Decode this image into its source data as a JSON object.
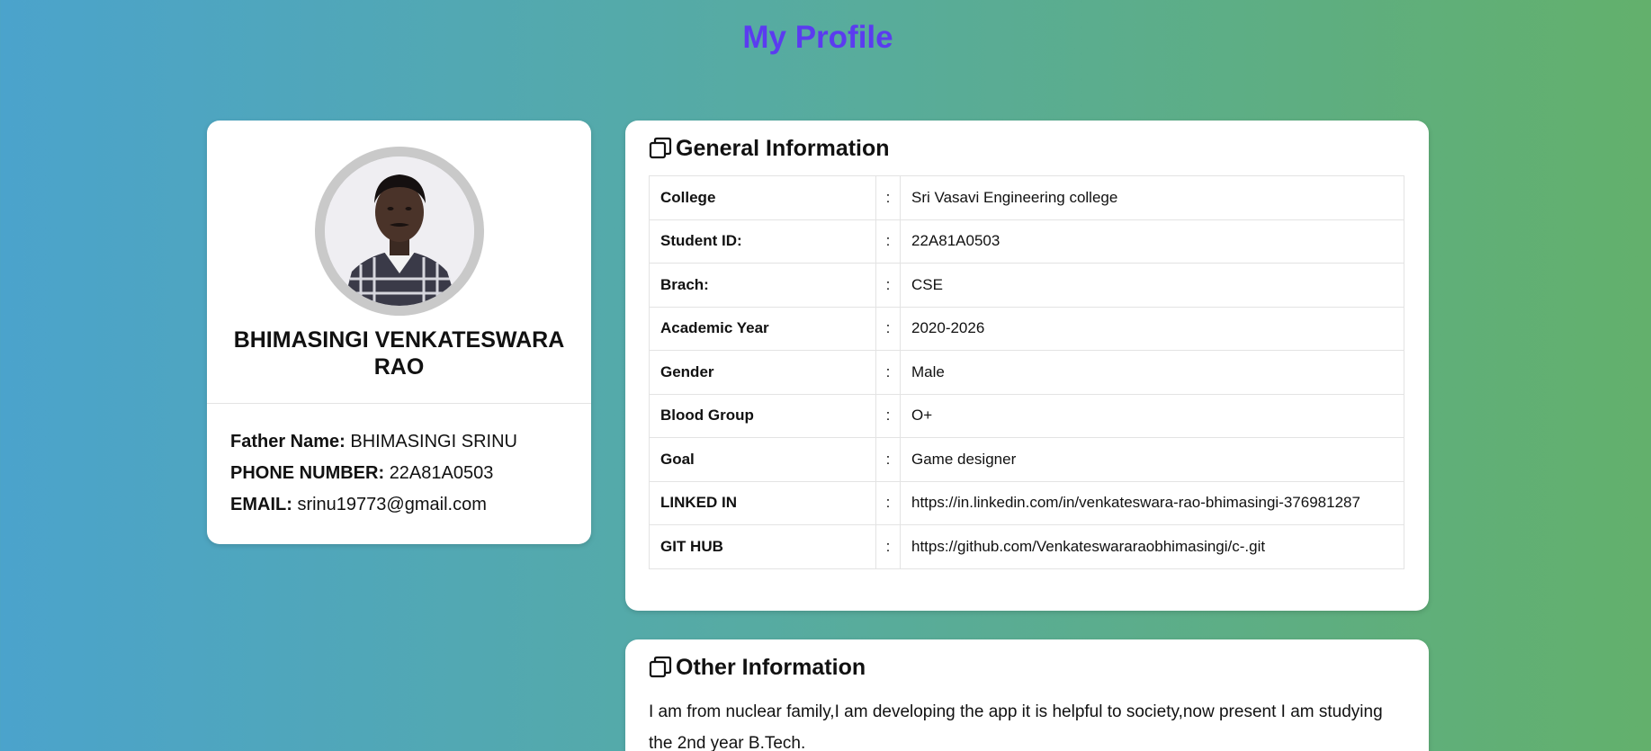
{
  "page": {
    "title": "My Profile"
  },
  "profile": {
    "name": "BHIMASINGI VENKATESWARA RAO",
    "details": [
      {
        "label": "Father Name:",
        "value": "BHIMASINGI SRINU"
      },
      {
        "label": "PHONE NUMBER:",
        "value": "22A81A0503"
      },
      {
        "label": "EMAIL:",
        "value": "srinu19773@gmail.com"
      }
    ]
  },
  "general": {
    "heading": "General Information",
    "icon": "copy-icon",
    "rows": [
      {
        "key": "College",
        "sep": ":",
        "value": "Sri Vasavi Engineering college"
      },
      {
        "key": "Student ID:",
        "sep": ":",
        "value": "22A81A0503"
      },
      {
        "key": "Brach:",
        "sep": ":",
        "value": "CSE"
      },
      {
        "key": "Academic Year",
        "sep": ":",
        "value": "2020-2026"
      },
      {
        "key": "Gender",
        "sep": ":",
        "value": "Male"
      },
      {
        "key": "Blood Group",
        "sep": ":",
        "value": "O+"
      },
      {
        "key": "Goal",
        "sep": ":",
        "value": "Game designer"
      },
      {
        "key": "LINKED IN",
        "sep": ":",
        "value": "https://in.linkedin.com/in/venkateswara-rao-bhimasingi-376981287"
      },
      {
        "key": "GIT HUB",
        "sep": ":",
        "value": "https://github.com/Venkateswararaobhimasingi/c-.git"
      }
    ]
  },
  "other": {
    "heading": "Other Information",
    "icon": "copy-icon",
    "text": "I am from nuclear family,I am developing the app it is helpful to society,now present I am studying the 2nd year B.Tech."
  },
  "colors": {
    "title": "#5b3bf0",
    "gradient_left": "#4ba3cc",
    "gradient_right": "#63b06c"
  }
}
